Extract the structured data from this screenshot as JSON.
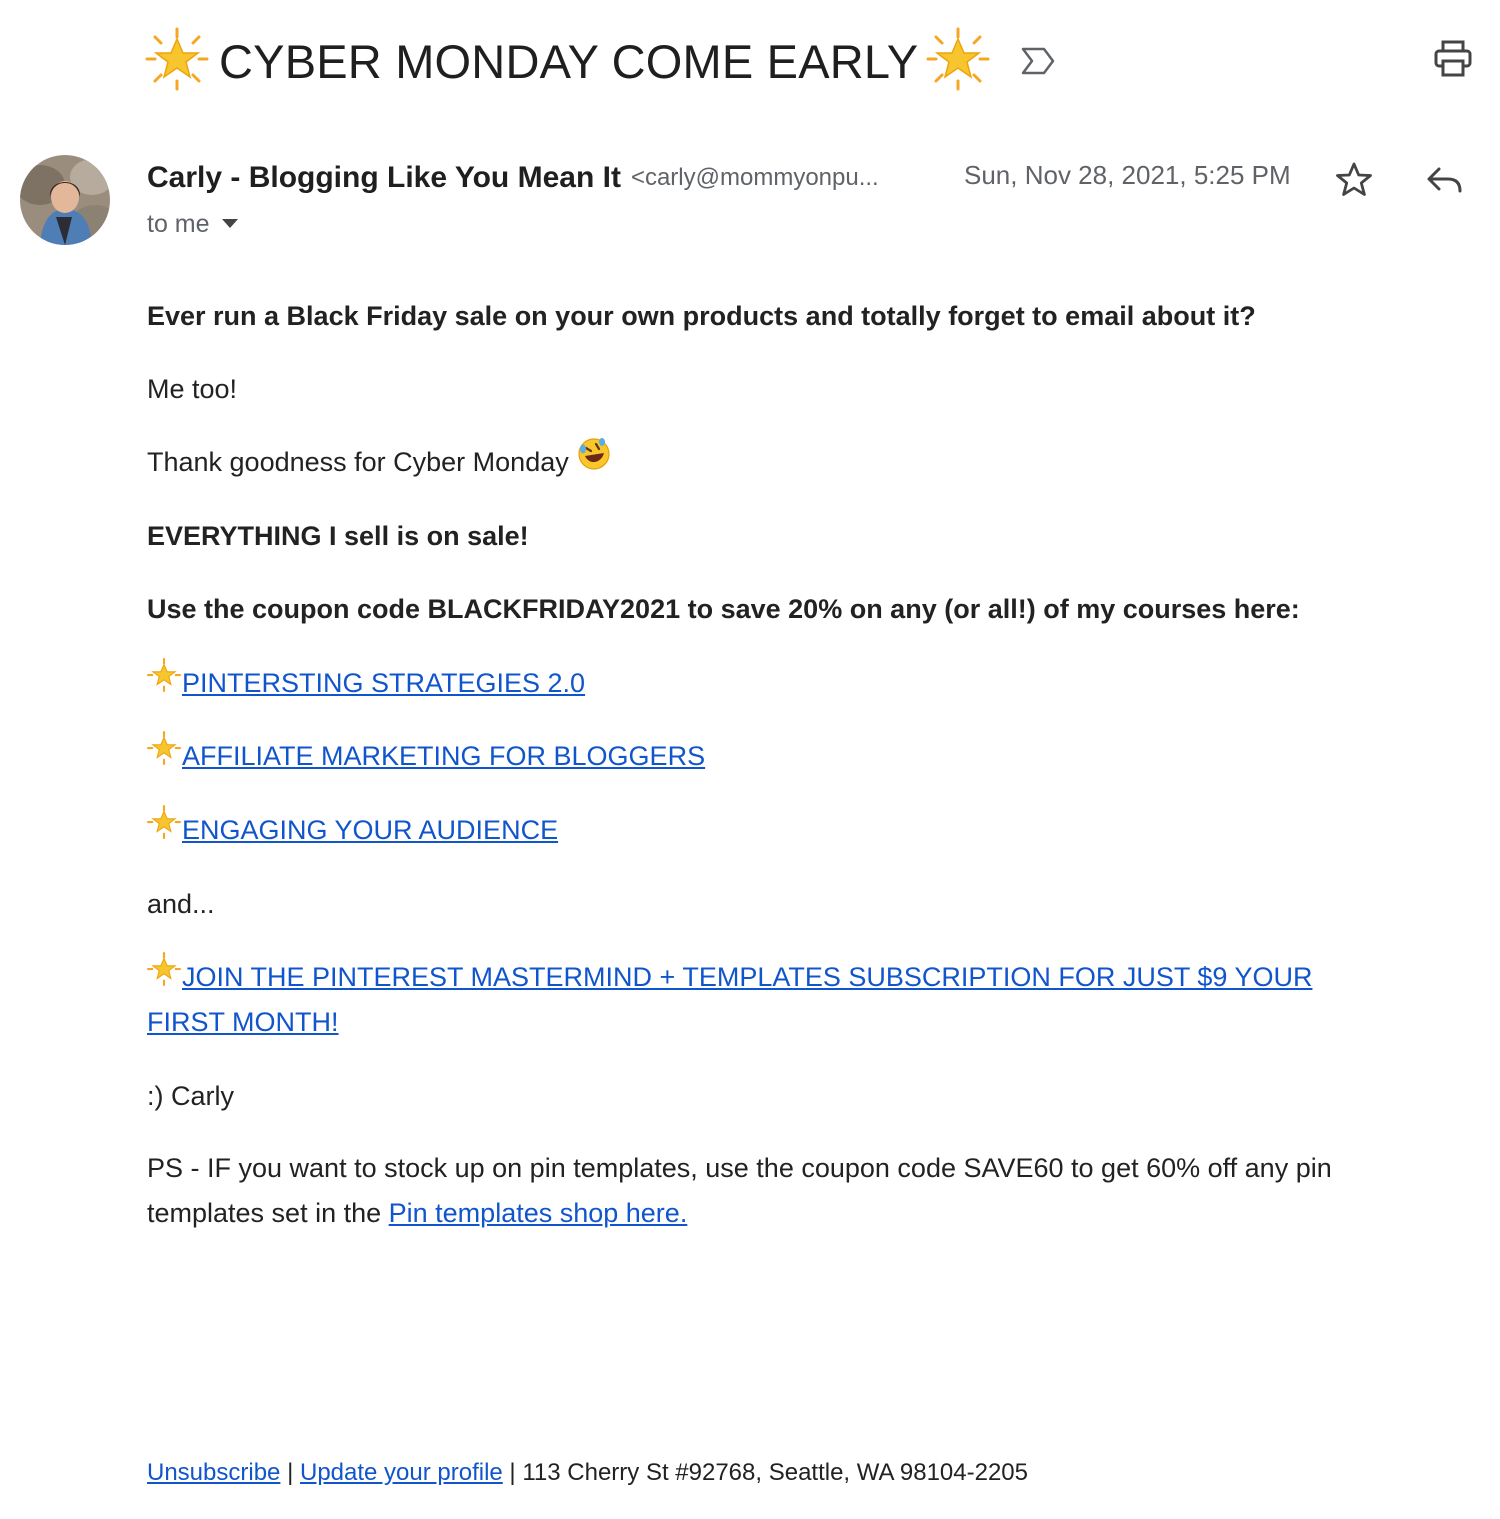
{
  "subject": {
    "text": "CYBER MONDAY COME EARLY",
    "leading_icon": "glowing-star-emoji",
    "trailing_icon": "glowing-star-emoji",
    "importance_icon": "importance-marker-icon"
  },
  "toolbar": {
    "print_icon": "print-icon"
  },
  "message": {
    "avatar_icon": "sender-avatar-photo",
    "sender_name": "Carly - Blogging Like You Mean It",
    "sender_email": "<carly@mommyonpu...",
    "date": "Sun, Nov 28, 2021, 5:25 PM",
    "star_icon": "star-outline-icon",
    "reply_icon": "reply-icon",
    "recipient": "to me",
    "recipient_icon": "caret-down-icon"
  },
  "body": {
    "p1": "Ever run a Black Friday sale on your own products and totally forget to email about it?",
    "p2": "Me too!",
    "p3": "Thank goodness for Cyber Monday",
    "p3_icon": "rolling-on-floor-laughing-emoji",
    "p4": "EVERYTHING I sell is on sale!",
    "p5": "Use the coupon code BLACKFRIDAY2021 to save 20% on any (or all!) of my courses here:",
    "links": [
      {
        "label": "PINTERSTING STRATEGIES 2.0 "
      },
      {
        "label": "AFFILIATE MARKETING FOR BLOGGERS"
      },
      {
        "label": "ENGAGING YOUR AUDIENCE "
      }
    ],
    "and_text": "and...",
    "mastermind_line1": "JOIN THE PINTEREST MASTERMIND + TEMPLATES SUBSCRIPTION FOR JUST $9 YOUR",
    "mastermind_line2": "FIRST MONTH! ",
    "signoff": ":) Carly",
    "ps_line1": "PS - IF you want to stock up on pin templates, use the coupon code SAVE60 to get 60% off any pin",
    "ps_line2_prefix": "templates set in the ",
    "ps_link": "Pin templates shop here. "
  },
  "footer": {
    "unsubscribe": "Unsubscribe",
    "sep1": " | ",
    "update_profile": "Update your profile",
    "address": " | 113 Cherry St #92768, Seattle, WA 98104-2205"
  },
  "colors": {
    "link": "#1155cc",
    "muted": "#5f6368",
    "text": "#222222",
    "star_yellow": "#f7c62f"
  }
}
